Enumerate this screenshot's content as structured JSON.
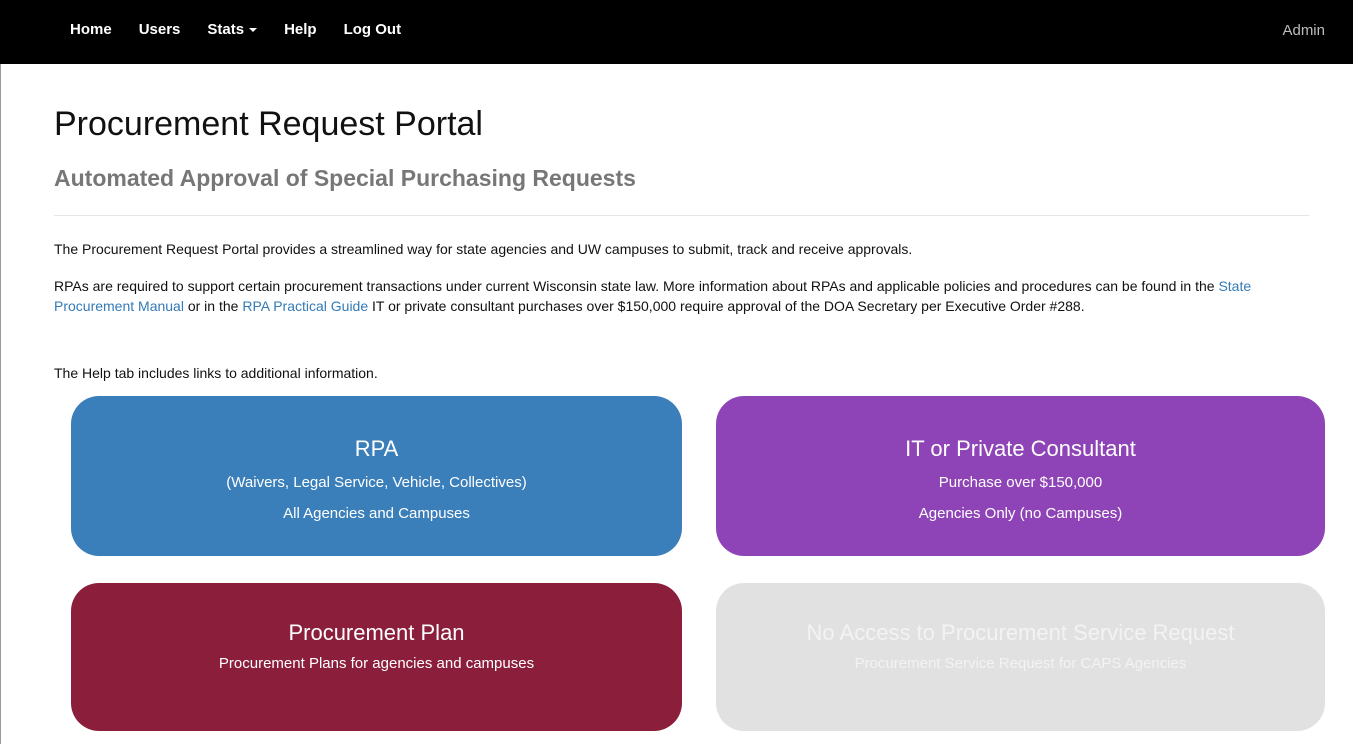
{
  "nav": {
    "items": [
      "Home",
      "Users",
      "Stats",
      "Help",
      "Log Out"
    ],
    "user": "Admin"
  },
  "header": {
    "title": "Procurement Request Portal",
    "subtitle": "Automated Approval of Special Purchasing Requests"
  },
  "intro": {
    "p1": "The Procurement Request Portal provides a streamlined way for state agencies and UW campuses to submit, track and receive approvals.",
    "p2_a": "RPAs are required to support certain procurement transactions under current Wisconsin state law. More information about RPAs and applicable policies and procedures can be found in the ",
    "p2_link1": "State Procurement Manual",
    "p2_b": " or in the ",
    "p2_link2": "RPA Practical Guide",
    "p2_c": " IT or private consultant purchases over $150,000 require approval of the DOA Secretary per Executive Order #288.",
    "p3": "The Help tab includes links to additional information."
  },
  "cards": [
    {
      "title": "RPA",
      "line1": "(Waivers, Legal Service, Vehicle, Collectives)",
      "line2": "All Agencies and Campuses",
      "color": "#3a7fba"
    },
    {
      "title": "IT or Private Consultant",
      "line1": "Purchase over $150,000",
      "line2": "Agencies Only (no Campuses)",
      "color": "#8e44b7"
    },
    {
      "title": "Procurement Plan",
      "line1": "Procurement Plans for agencies and campuses",
      "color": "#8b1f3b"
    },
    {
      "title": "No Access to Procurement Service Request",
      "line1": "Procurement Service Request for CAPS Agencies",
      "color": "#e1e1e1"
    }
  ]
}
